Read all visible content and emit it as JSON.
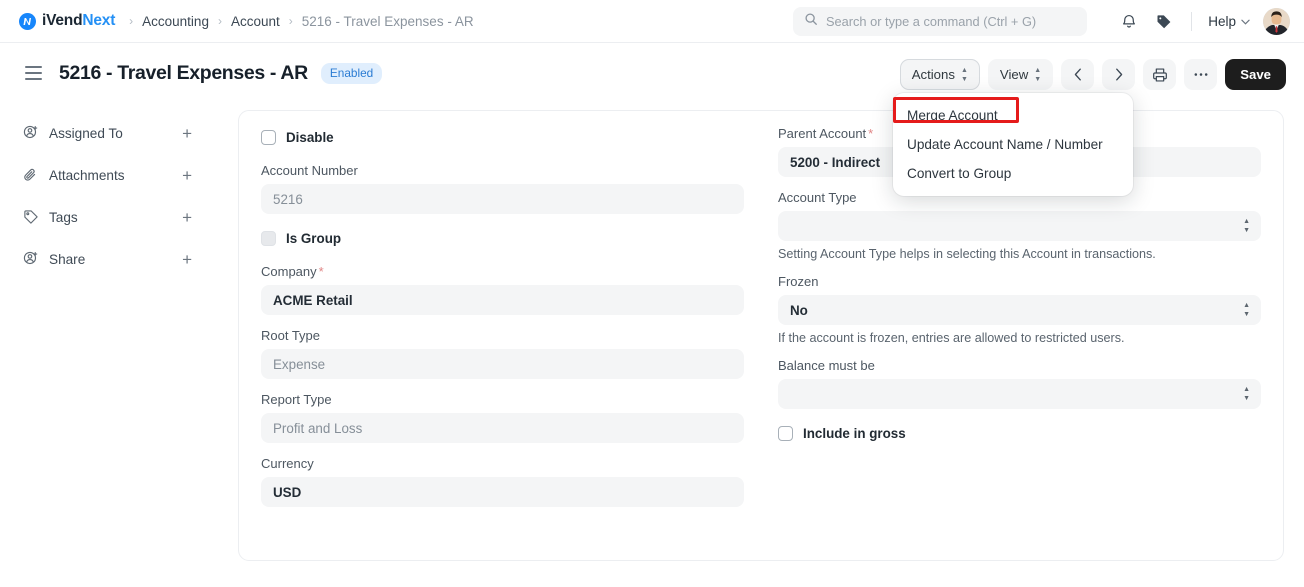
{
  "brand": {
    "name_dark": "iVend",
    "name_blue": "Next",
    "logo_icon": "ivendnext-logo-icon"
  },
  "breadcrumb": [
    {
      "label": "Accounting",
      "muted": false
    },
    {
      "label": "Account",
      "muted": false
    },
    {
      "label": "5216 - Travel Expenses - AR",
      "muted": true
    }
  ],
  "search": {
    "placeholder": "Search or type a command (Ctrl + G)",
    "value": "",
    "icon": "search-icon"
  },
  "navbar": {
    "notifications_icon": "bell-icon",
    "tags_icon": "tag-icon",
    "help_label": "Help",
    "help_caret_icon": "chevron-down-icon",
    "avatar_icon": "user-avatar"
  },
  "page": {
    "menu_icon": "hamburger-icon",
    "title": "5216 - Travel Expenses - AR",
    "status_badge": "Enabled"
  },
  "toolbar": {
    "actions_label": "Actions",
    "view_label": "View",
    "prev_icon": "chevron-left-icon",
    "next_icon": "chevron-right-icon",
    "print_icon": "printer-icon",
    "more_icon": "ellipsis-icon",
    "save_label": "Save"
  },
  "actions_menu": {
    "open": true,
    "highlight_color": "#e51b1b",
    "items": [
      {
        "label": "Merge Account",
        "highlighted": true
      },
      {
        "label": "Update Account Name / Number",
        "highlighted": false
      },
      {
        "label": "Convert to Group",
        "highlighted": false
      }
    ]
  },
  "sidebar": {
    "items": [
      {
        "label": "Assigned To",
        "icon": "assign-user-icon",
        "add_icon": "plus-icon"
      },
      {
        "label": "Attachments",
        "icon": "paperclip-icon",
        "add_icon": "plus-icon"
      },
      {
        "label": "Tags",
        "icon": "tag-icon",
        "add_icon": "plus-icon"
      },
      {
        "label": "Share",
        "icon": "share-user-icon",
        "add_icon": "plus-icon"
      }
    ]
  },
  "form": {
    "left": {
      "disable_checkbox": {
        "label": "Disable",
        "checked": false
      },
      "account_number": {
        "label": "Account Number",
        "value": "5216"
      },
      "is_group_checkbox": {
        "label": "Is Group",
        "checked": false,
        "disabled": true
      },
      "company": {
        "label": "Company",
        "required": true,
        "value": "ACME Retail"
      },
      "root_type": {
        "label": "Root Type",
        "value": "Expense"
      },
      "report_type": {
        "label": "Report Type",
        "value": "Profit and Loss"
      },
      "currency": {
        "label": "Currency",
        "value": "USD"
      }
    },
    "right": {
      "parent_account": {
        "label": "Parent Account",
        "required": true,
        "value": "5200 - Indirect"
      },
      "account_type": {
        "label": "Account Type",
        "value": "",
        "hint": "Setting Account Type helps in selecting this Account in transactions."
      },
      "frozen": {
        "label": "Frozen",
        "value": "No",
        "hint": "If the account is frozen, entries are allowed to restricted users."
      },
      "balance_must_be": {
        "label": "Balance must be",
        "value": ""
      },
      "include_in_gross_checkbox": {
        "label": "Include in gross",
        "checked": false
      }
    }
  }
}
